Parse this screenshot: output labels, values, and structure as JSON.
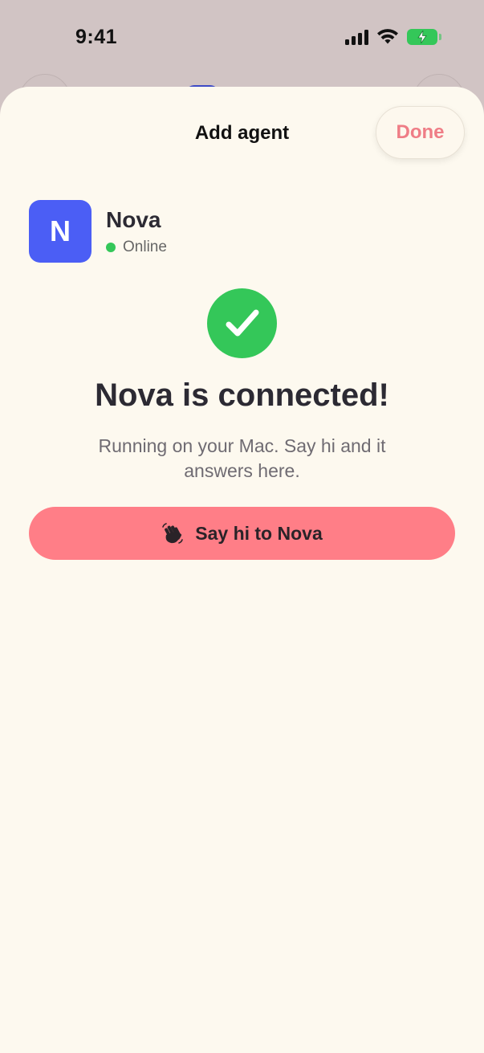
{
  "status_bar": {
    "time": "9:41",
    "battery_color": "#34c759"
  },
  "sheet": {
    "title": "Add agent",
    "done_label": "Done",
    "accent_color": "#ef7d86",
    "background": "#fdf9ef"
  },
  "agent": {
    "initial": "N",
    "name": "Nova",
    "status": "Online",
    "avatar_color": "#4b5ef5",
    "status_color": "#34c759"
  },
  "success": {
    "icon": "check-icon",
    "headline": "Nova is connected!",
    "subtext": "Running on your Mac. Say hi and it answers here."
  },
  "cta": {
    "icon": "waving-hand-icon",
    "label": "Say hi to Nova",
    "color": "#ff7e87"
  }
}
